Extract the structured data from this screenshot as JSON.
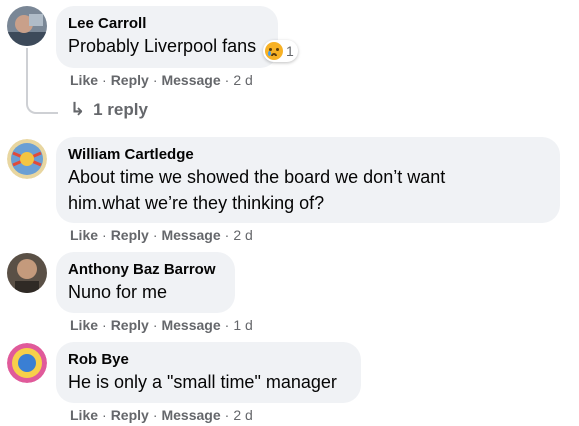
{
  "comments": [
    {
      "author": "Lee Carroll",
      "text": "Probably Liverpool fans",
      "reaction": {
        "icon": "sad-face-icon",
        "count": "1"
      },
      "actions": {
        "like": "Like",
        "reply": "Reply",
        "message": "Message",
        "time": "2 d"
      }
    },
    {
      "author": "William Cartledge",
      "text_lines": [
        "About time we showed the board we don’t want",
        "him.what we’re they thinking of?"
      ],
      "actions": {
        "like": "Like",
        "reply": "Reply",
        "message": "Message",
        "time": "2 d"
      }
    },
    {
      "author": "Anthony Baz Barrow",
      "text": "Nuno for me",
      "actions": {
        "like": "Like",
        "reply": "Reply",
        "message": "Message",
        "time": "1 d"
      }
    },
    {
      "author": "Rob Bye",
      "text": "He is only a \"small time\" manager",
      "actions": {
        "like": "Like",
        "reply": "Reply",
        "message": "Message",
        "time": "2 d"
      }
    }
  ],
  "replies_link": {
    "icon": "reply-arrow-icon",
    "label": "1 reply"
  },
  "separator": "·",
  "colors": {
    "bubble": "#f0f2f5",
    "meta": "#65676b",
    "text": "#050505"
  }
}
